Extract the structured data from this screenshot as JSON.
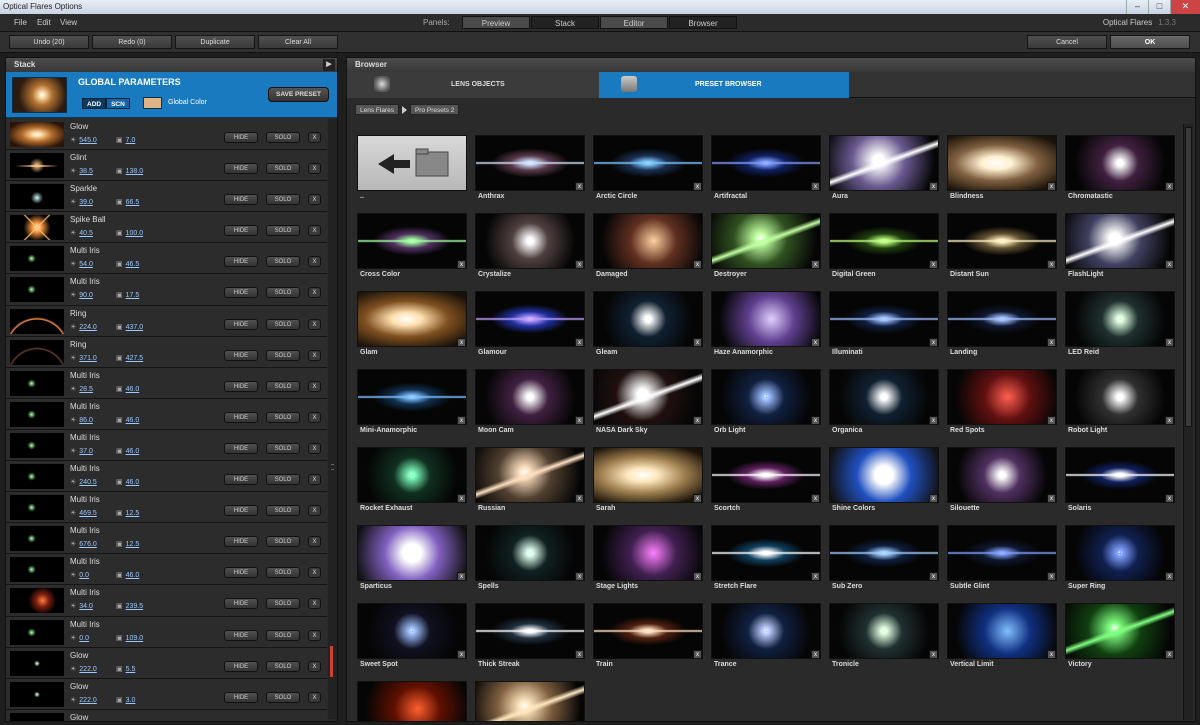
{
  "window": {
    "title": "Optical Flares Options"
  },
  "menu": [
    "File",
    "Edit",
    "View"
  ],
  "panels": {
    "label": "Panels:",
    "tabs": [
      "Preview",
      "Stack",
      "Editor",
      "Browser"
    ]
  },
  "app": {
    "name": "Optical Flares",
    "version": "1.3.3"
  },
  "toolbar": {
    "undo": "Undo (20)",
    "redo": "Redo (0)",
    "duplicate": "Duplicate",
    "clear": "Clear All",
    "cancel": "Cancel",
    "ok": "OK"
  },
  "stack": {
    "title": "Stack",
    "global": {
      "title": "GLOBAL PARAMETERS",
      "add": "ADD",
      "scn": "SCN",
      "color_label": "Global Color",
      "color": "#e2b385",
      "save": "SAVE PRESET"
    },
    "hide_label": "HIDE",
    "solo_label": "SOLO",
    "x_label": "X",
    "layers": [
      {
        "name": "Glow",
        "v1": "545.0",
        "v2": "7.0",
        "kind": "glow"
      },
      {
        "name": "Glint",
        "v1": "38.5",
        "v2": "138.0",
        "kind": "glint"
      },
      {
        "name": "Sparkle",
        "v1": "39.0",
        "v2": "66.5",
        "kind": "sparkle"
      },
      {
        "name": "Spike Ball",
        "v1": "40.5",
        "v2": "100.0",
        "kind": "spike"
      },
      {
        "name": "Multi Iris",
        "v1": "54.0",
        "v2": "46.5",
        "kind": "iris"
      },
      {
        "name": "Multi Iris",
        "v1": "90.0",
        "v2": "17.5",
        "kind": "iris"
      },
      {
        "name": "Ring",
        "v1": "224.0",
        "v2": "437.0",
        "kind": "ring"
      },
      {
        "name": "Ring",
        "v1": "371.0",
        "v2": "427.5",
        "kind": "ring2"
      },
      {
        "name": "Multi Iris",
        "v1": "28.5",
        "v2": "46.0",
        "kind": "iris"
      },
      {
        "name": "Multi Iris",
        "v1": "86.0",
        "v2": "46.0",
        "kind": "iris"
      },
      {
        "name": "Multi Iris",
        "v1": "37.0",
        "v2": "46.0",
        "kind": "iris"
      },
      {
        "name": "Multi Iris",
        "v1": "240.5",
        "v2": "46.0",
        "kind": "iris"
      },
      {
        "name": "Multi Iris",
        "v1": "469.5",
        "v2": "12.5",
        "kind": "iris"
      },
      {
        "name": "Multi Iris",
        "v1": "676.0",
        "v2": "12.5",
        "kind": "iris"
      },
      {
        "name": "Multi Iris",
        "v1": "0.0",
        "v2": "46.0",
        "kind": "iris"
      },
      {
        "name": "Multi Iris",
        "v1": "34.0",
        "v2": "239.5",
        "kind": "orange"
      },
      {
        "name": "Multi Iris",
        "v1": "0.0",
        "v2": "109.0",
        "kind": "iris"
      },
      {
        "name": "Glow",
        "v1": "222.0",
        "v2": "5.5",
        "kind": "dot"
      },
      {
        "name": "Glow",
        "v1": "222.0",
        "v2": "3.0",
        "kind": "dot"
      },
      {
        "name": "Glow",
        "v1": "",
        "v2": "",
        "kind": "dot"
      }
    ]
  },
  "browser": {
    "title": "Browser",
    "tabs": {
      "lens": "LENS OBJECTS",
      "preset": "PRESET BROWSER"
    },
    "crumbs": [
      "Lens Flares",
      "Pro Presets 2"
    ],
    "x_label": "x",
    "presets": [
      {
        "name": "..",
        "c": "#fff",
        "a": "#888",
        "style": "folder"
      },
      {
        "name": "Anthrax",
        "c": "#cfe0ff",
        "a": "#5a3a4a",
        "style": "streak"
      },
      {
        "name": "Arctic Circle",
        "c": "#80c8ff",
        "a": "#1a3050",
        "style": "streak"
      },
      {
        "name": "Artifractal",
        "c": "#80a0ff",
        "a": "#102060",
        "style": "streak"
      },
      {
        "name": "Aura",
        "c": "#ffffff",
        "a": "#6a5a90",
        "style": "diag"
      },
      {
        "name": "Blindness",
        "c": "#fff0d0",
        "a": "#806040",
        "style": "wide"
      },
      {
        "name": "Chromatastic",
        "c": "#ffffff",
        "a": "#402040",
        "style": "star"
      },
      {
        "name": "Cross Color",
        "c": "#a0ffa0",
        "a": "#503060",
        "style": "streak"
      },
      {
        "name": "Crystalize",
        "c": "#ffffff",
        "a": "#504040",
        "style": "star"
      },
      {
        "name": "Damaged",
        "c": "#ffd0a0",
        "a": "#603020",
        "style": "glow"
      },
      {
        "name": "Destroyer",
        "c": "#c0ffa0",
        "a": "#305020",
        "style": "diag"
      },
      {
        "name": "Digital Green",
        "c": "#c0ff80",
        "a": "#204010",
        "style": "streak"
      },
      {
        "name": "Distant Sun",
        "c": "#fff0c0",
        "a": "#605030",
        "style": "streak"
      },
      {
        "name": "FlashLight",
        "c": "#ffffff",
        "a": "#404060",
        "style": "diag"
      },
      {
        "name": "Glam",
        "c": "#ffe0b0",
        "a": "#805020",
        "style": "wide"
      },
      {
        "name": "Glamour",
        "c": "#c0a0ff",
        "a": "#2030a0",
        "style": "streak"
      },
      {
        "name": "Gleam",
        "c": "#ffffff",
        "a": "#102030",
        "style": "star"
      },
      {
        "name": "Haze Anamorphic",
        "c": "#e0d0ff",
        "a": "#604090",
        "style": "glow"
      },
      {
        "name": "Illuminati",
        "c": "#a0c0ff",
        "a": "#102040",
        "style": "streak"
      },
      {
        "name": "Landing",
        "c": "#a0c0ff",
        "a": "#101830",
        "style": "streak"
      },
      {
        "name": "LED Reid",
        "c": "#e0ffe0",
        "a": "#203030",
        "style": "star"
      },
      {
        "name": "Mini-Anamorphic",
        "c": "#80c0ff",
        "a": "#103050",
        "style": "streak"
      },
      {
        "name": "Moon Cam",
        "c": "#ffffff",
        "a": "#402040",
        "style": "star"
      },
      {
        "name": "NASA Dark Sky",
        "c": "#ffffff",
        "a": "#201010",
        "style": "diag"
      },
      {
        "name": "Orb Light",
        "c": "#a0c0ff",
        "a": "#102040",
        "style": "star"
      },
      {
        "name": "Organica",
        "c": "#ffffff",
        "a": "#102030",
        "style": "star"
      },
      {
        "name": "Red Spots",
        "c": "#ff6050",
        "a": "#601010",
        "style": "glow"
      },
      {
        "name": "Robot Light",
        "c": "#ffffff",
        "a": "#303030",
        "style": "star"
      },
      {
        "name": "Rocket Exhaust",
        "c": "#80ffc0",
        "a": "#103020",
        "style": "star"
      },
      {
        "name": "Russian",
        "c": "#ffe0c0",
        "a": "#504030",
        "style": "diag"
      },
      {
        "name": "Sarah",
        "c": "#ffe8c0",
        "a": "#a08050",
        "style": "wide"
      },
      {
        "name": "Scortch",
        "c": "#ffffff",
        "a": "#602060",
        "style": "streak"
      },
      {
        "name": "Shine Colors",
        "c": "#ffffff",
        "a": "#2050c0",
        "style": "burst"
      },
      {
        "name": "Silouette",
        "c": "#ffffff",
        "a": "#503060",
        "style": "star"
      },
      {
        "name": "Solaris",
        "c": "#ffffff",
        "a": "#102060",
        "style": "streak"
      },
      {
        "name": "Sparticus",
        "c": "#ffffff",
        "a": "#8060c0",
        "style": "burst"
      },
      {
        "name": "Spells",
        "c": "#e0fff0",
        "a": "#102020",
        "style": "star"
      },
      {
        "name": "Stage Lights",
        "c": "#ff80ff",
        "a": "#402050",
        "style": "glow"
      },
      {
        "name": "Stretch Flare",
        "c": "#ffffff",
        "a": "#104060",
        "style": "streak"
      },
      {
        "name": "Sub Zero",
        "c": "#a0d0ff",
        "a": "#102040",
        "style": "streak"
      },
      {
        "name": "Subtle Glint",
        "c": "#80a0ff",
        "a": "#101830",
        "style": "streak"
      },
      {
        "name": "Super Ring",
        "c": "#80a0ff",
        "a": "#102050",
        "style": "star"
      },
      {
        "name": "Sweet Spot",
        "c": "#a0c0ff",
        "a": "#101020",
        "style": "star"
      },
      {
        "name": "Thick Streak",
        "c": "#ffffff",
        "a": "#203040",
        "style": "streak"
      },
      {
        "name": "Train",
        "c": "#ffe0c0",
        "a": "#502010",
        "style": "streak"
      },
      {
        "name": "Trance",
        "c": "#c0d0ff",
        "a": "#102040",
        "style": "star"
      },
      {
        "name": "Tronicle",
        "c": "#e0ffe0",
        "a": "#203030",
        "style": "star"
      },
      {
        "name": "Vertical Limit",
        "c": "#80c0ff",
        "a": "#103080",
        "style": "glow"
      },
      {
        "name": "Victory",
        "c": "#80ff80",
        "a": "#104010",
        "style": "diag"
      },
      {
        "name": "",
        "c": "#ff6030",
        "a": "#601000",
        "style": "glow"
      },
      {
        "name": "",
        "c": "#ffe8c0",
        "a": "#806040",
        "style": "diag"
      }
    ]
  }
}
